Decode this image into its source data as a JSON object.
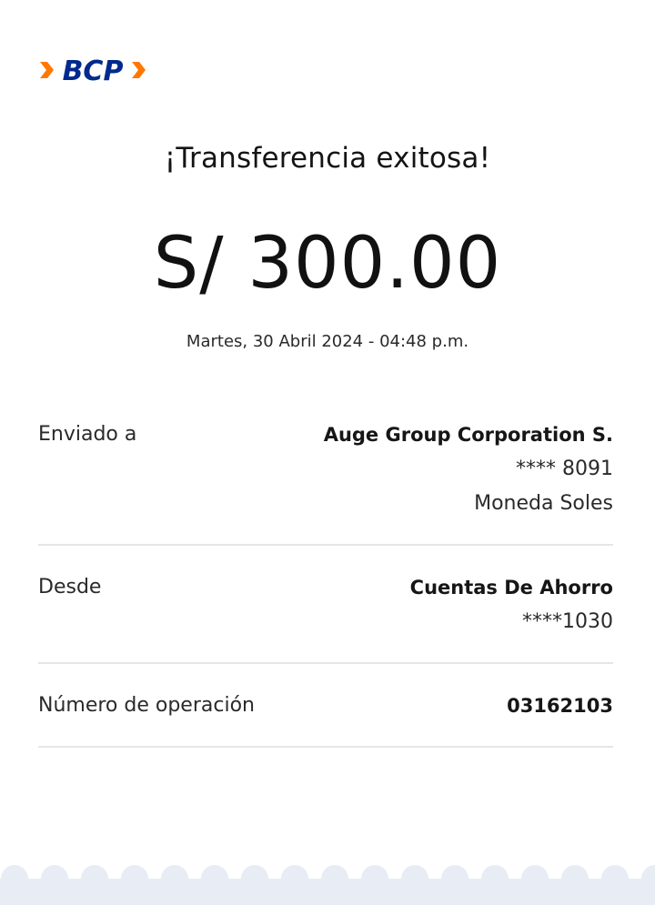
{
  "brand": {
    "logo_text": "BCP",
    "colors": {
      "navy": "#002a8d",
      "orange": "#ff7800",
      "footer_bg": "#e8edf5"
    }
  },
  "title": "¡Transferencia exitosa!",
  "amount": "S/ 300.00",
  "datetime": "Martes, 30 Abril 2024 - 04:48 p.m.",
  "details": {
    "sent_to": {
      "label": "Enviado a",
      "name": "Auge Group Corporation S.",
      "account": "**** 8091",
      "currency": "Moneda Soles"
    },
    "from": {
      "label": "Desde",
      "account_type": "Cuentas De Ahorro",
      "account": "****1030"
    },
    "operation": {
      "label": "Número de operación",
      "number": "03162103"
    }
  }
}
